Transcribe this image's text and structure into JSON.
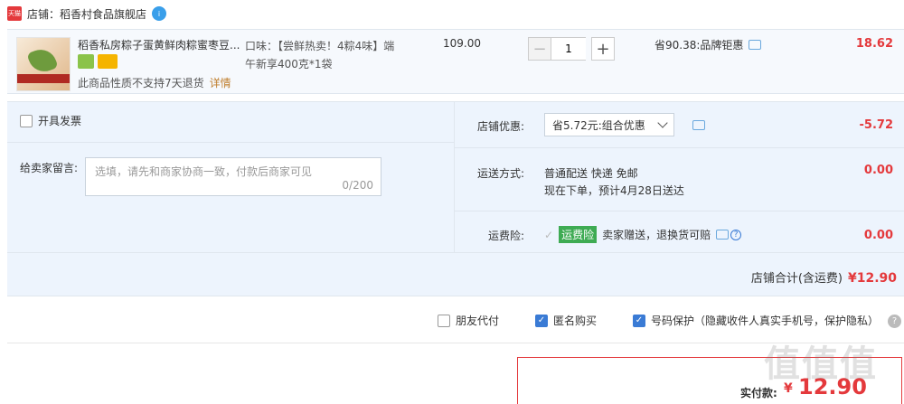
{
  "store": {
    "badge": "天猫",
    "label": "店铺：稻香村食品旗舰店",
    "chat_badge": "i"
  },
  "product": {
    "title": "稻香私房粽子蛋黄鲜肉粽蜜枣豆...",
    "sku_line1": "口味：【尝鲜热卖！4粽4味】端",
    "sku_line2": "午新享400克*1袋",
    "return_note": "此商品性质不支持7天退货",
    "return_link": "详情",
    "unit_price": "109.00",
    "quantity": "1",
    "minus": "−",
    "plus": "+",
    "discount": "省90.38:品牌钜惠",
    "line_total": "18.62"
  },
  "extras": {
    "invoice_label": "开具发票",
    "message_label": "给卖家留言:",
    "message_placeholder": "选填，请先和商家协商一致，付款后商家可见",
    "message_count": "0/200",
    "store_discount_label": "店铺优惠:",
    "coupon_selected": "省5.72元:组合优惠",
    "store_discount_amount": "-5.72",
    "shipping_label": "运送方式:",
    "shipping_line1": "普通配送 快递 免邮",
    "shipping_line2": "现在下单，预计4月28日送达",
    "shipping_amount": "0.00",
    "insurance_label": "运费险:",
    "insurance_tag": "运费险",
    "insurance_text": "卖家赠送，退换货可赔",
    "insurance_amount": "0.00",
    "store_total_label": "店铺合计(含运费)",
    "store_total_amount": "¥12.90"
  },
  "options": {
    "friend_pay": "朋友代付",
    "anonymous": "匿名购买",
    "number_protect": "号码保护（隐藏收件人真实手机号，保护隐私）"
  },
  "payment": {
    "label": "实付款:",
    "currency": "¥",
    "amount": "12.90"
  },
  "watermark": "值值值"
}
